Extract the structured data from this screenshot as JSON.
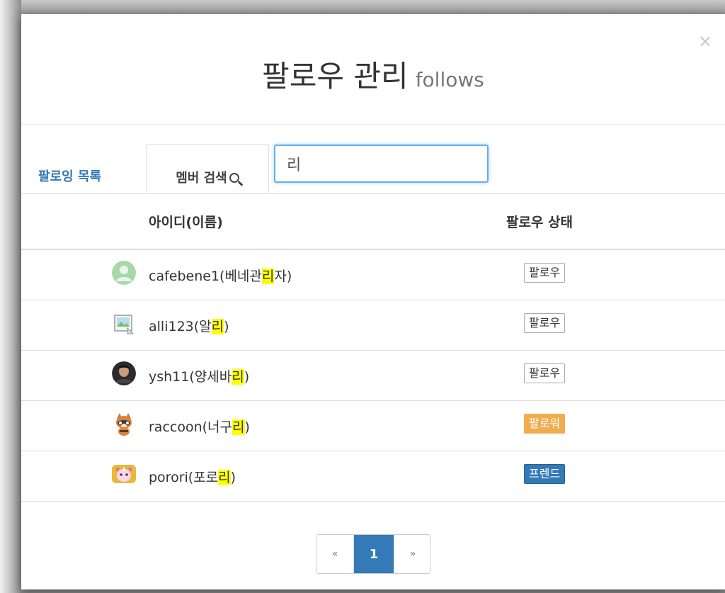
{
  "dialog": {
    "title": "팔로우 관리",
    "subtitle": "follows",
    "close_glyph": "×"
  },
  "tabs": {
    "following": "팔로잉 목록",
    "search": "멤버 검색"
  },
  "search": {
    "value": "리",
    "placeholder": ""
  },
  "table": {
    "headers": [
      "아이디(이름)",
      "팔로우 상태"
    ],
    "rows": [
      {
        "name_pre": "cafebene1(베네관",
        "name_hl": "리",
        "name_post": "자)",
        "avatar": "default-user-avatar",
        "status": "팔로우"
      },
      {
        "name_pre": "alli123(알",
        "name_hl": "리",
        "name_post": ")",
        "avatar": "broken-image-avatar",
        "status": "팔로우"
      },
      {
        "name_pre": "ysh11(양세바",
        "name_hl": "리",
        "name_post": ")",
        "avatar": "photo-avatar",
        "status": "팔로우"
      },
      {
        "name_pre": "raccoon(너구",
        "name_hl": "리",
        "name_post": ")",
        "avatar": "raccoon-avatar",
        "status": "팔로워"
      },
      {
        "name_pre": "porori(포로",
        "name_hl": "리",
        "name_post": ")",
        "avatar": "unicorn-avatar",
        "status": "프렌드"
      }
    ]
  },
  "pagination": {
    "prev": "«",
    "current": "1",
    "next": "»"
  },
  "colors": {
    "primary": "#337ab7",
    "follower_badge": "#f0ad4e",
    "highlight": "#ffff00"
  }
}
